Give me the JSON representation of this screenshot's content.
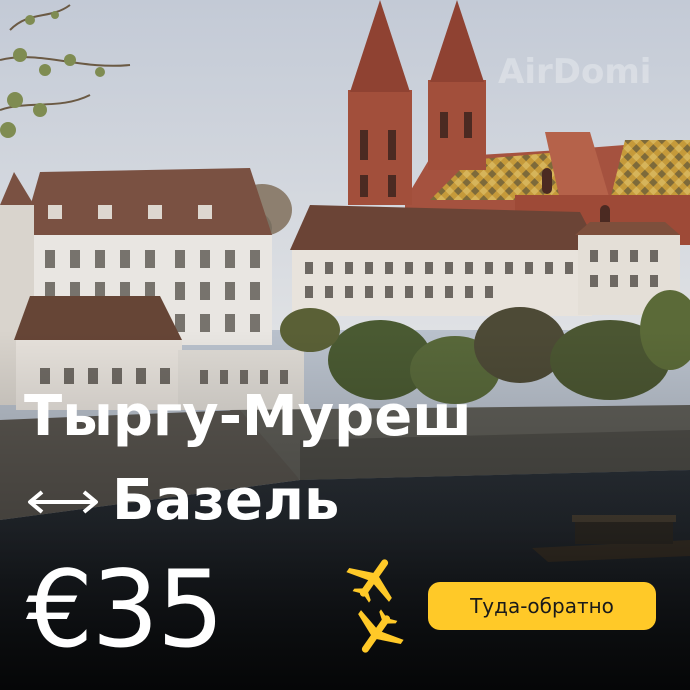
{
  "brand": {
    "watermark": "AirDomi"
  },
  "route": {
    "from": "Тыргу-Муреш",
    "to": "Базель",
    "arrow_icon": "double-arrow-icon"
  },
  "offer": {
    "price": "€35",
    "trip_type": "Туда-обратно",
    "plane_icon": "airplane-icon",
    "badge_color": "#ffc928"
  }
}
